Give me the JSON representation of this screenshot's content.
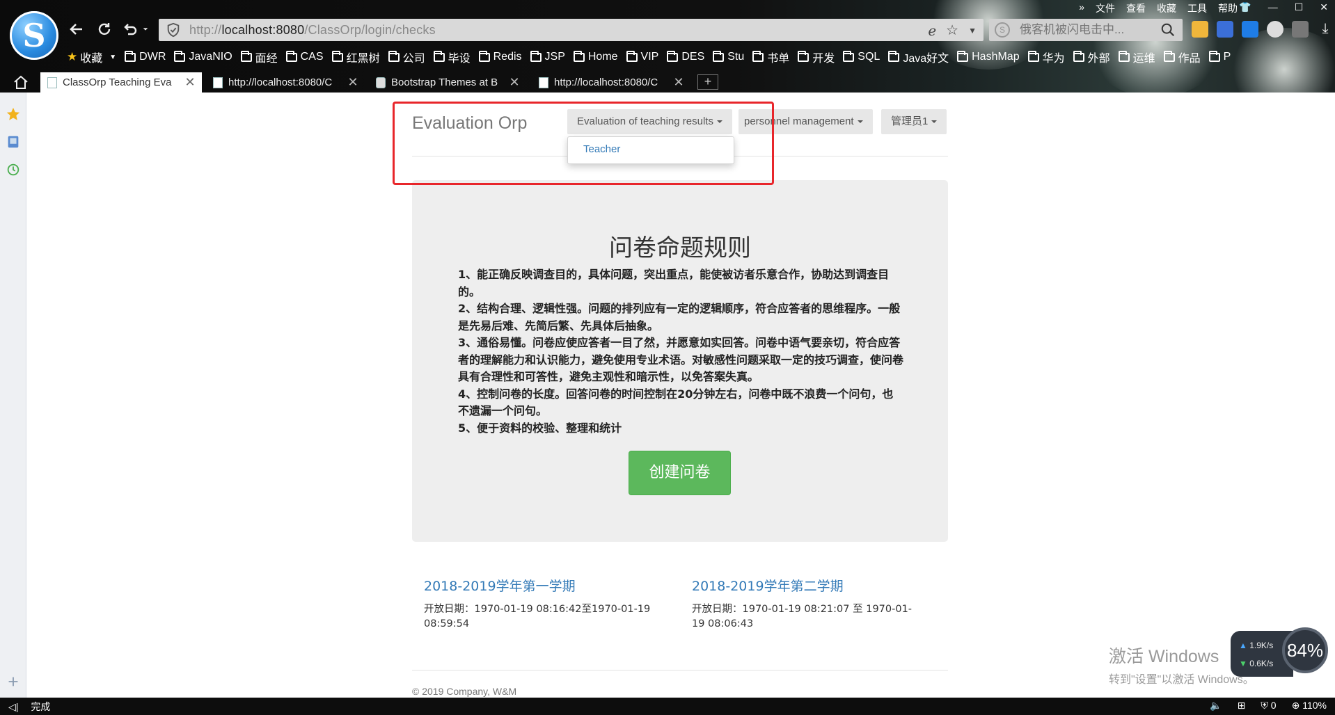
{
  "browser": {
    "url_prefix": "http://",
    "url_host": "localhost:8080",
    "url_path": "/ClassOrp/login/checks",
    "search_placeholder": "俄客机被闪电击中...",
    "top_menu": [
      "文件",
      "查看",
      "收藏",
      "工具",
      "帮助"
    ],
    "bookmarks": [
      "收藏",
      "DWR",
      "JavaNIO",
      "面经",
      "CAS",
      "红黑树",
      "公司",
      "毕设",
      "Redis",
      "JSP",
      "Home",
      "VIP",
      "DES",
      "Stu",
      "书单",
      "开发",
      "SQL",
      "Java好文",
      "HashMap",
      "华为",
      "外部",
      "运维",
      "作品",
      "P"
    ],
    "tabs": [
      {
        "label": "ClassOrp Teaching Eva"
      },
      {
        "label": "http://localhost:8080/C"
      },
      {
        "label": "Bootstrap Themes at B"
      },
      {
        "label": "http://localhost:8080/C"
      }
    ],
    "new_tab": "+",
    "status_left": "完成",
    "status_zoom": "110%",
    "status_count": "0",
    "speed_up": "1.9K/s",
    "speed_down": "0.6K/s",
    "speed_percent": "84%"
  },
  "navbar": {
    "brand": "Evaluation Orp",
    "menu1": "Evaluation of teaching results",
    "menu2": "personnel management",
    "menu3": "管理员1",
    "dropdown_items": [
      "Teacher"
    ]
  },
  "jumbotron": {
    "title": "问卷命题规则",
    "rules": [
      "1、能正确反映调查目的，具体问题，突出重点，能使被访者乐意合作，协助达到调查目的。",
      "2、结构合理、逻辑性强。问题的排列应有一定的逻辑顺序，符合应答者的思维程序。一般是先易后难、先简后繁、先具体后抽象。",
      "3、通俗易懂。问卷应使应答者一目了然，并愿意如实回答。问卷中语气要亲切，符合应答者的理解能力和认识能力，避免使用专业术语。对敏感性问题采取一定的技巧调查，使问卷具有合理性和可答性，避免主观性和暗示性，以免答案失真。",
      "4、控制问卷的长度。回答问卷的时间控制在20分钟左右，问卷中既不浪费一个问句，也不遗漏一个问句。",
      "5、便于资料的校验、整理和统计"
    ],
    "button": "创建问卷"
  },
  "semesters": [
    {
      "title": "2018-2019学年第一学期",
      "dates": "开放日期：1970-01-19 08:16:42至1970-01-19 08:59:54"
    },
    {
      "title": "2018-2019学年第二学期",
      "dates": "开放日期：1970-01-19 08:21:07 至 1970-01-19 08:06:43"
    }
  ],
  "footer": "© 2019 Company, W&M",
  "watermark": {
    "line1": "激活 Windows",
    "line2": "转到\"设置\"以激活 Windows。"
  }
}
